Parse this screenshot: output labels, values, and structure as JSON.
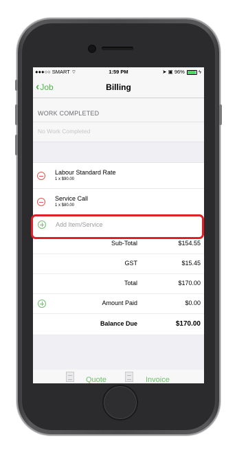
{
  "status_bar": {
    "carrier": "●●●○○ SMART",
    "time": "1:59 PM",
    "battery": "96%",
    "battery_level": 0.96
  },
  "nav": {
    "back_label": "Job",
    "title": "Billing"
  },
  "work_section": {
    "header": "WORK COMPLETED",
    "empty_text": "No Work Completed"
  },
  "items": [
    {
      "name": "Labour Standard Rate",
      "detail": "1 x $90.00"
    },
    {
      "name": "Service Call",
      "detail": "1 x $80.00"
    }
  ],
  "add_item_label": "Add Item/Service",
  "totals": {
    "subtotal_label": "Sub-Total",
    "subtotal_value": "$154.55",
    "gst_label": "GST",
    "gst_value": "$15.45",
    "total_label": "Total",
    "total_value": "$170.00",
    "paid_label": "Amount Paid",
    "paid_value": "$0.00",
    "due_label": "Balance Due",
    "due_value": "$170.00"
  },
  "bottom_bar": {
    "quote_label": "Quote",
    "invoice_label": "Invoice"
  },
  "colors": {
    "accent_green": "#4cb848",
    "delete_red": "#e2574c",
    "highlight_red": "#e11f26"
  }
}
